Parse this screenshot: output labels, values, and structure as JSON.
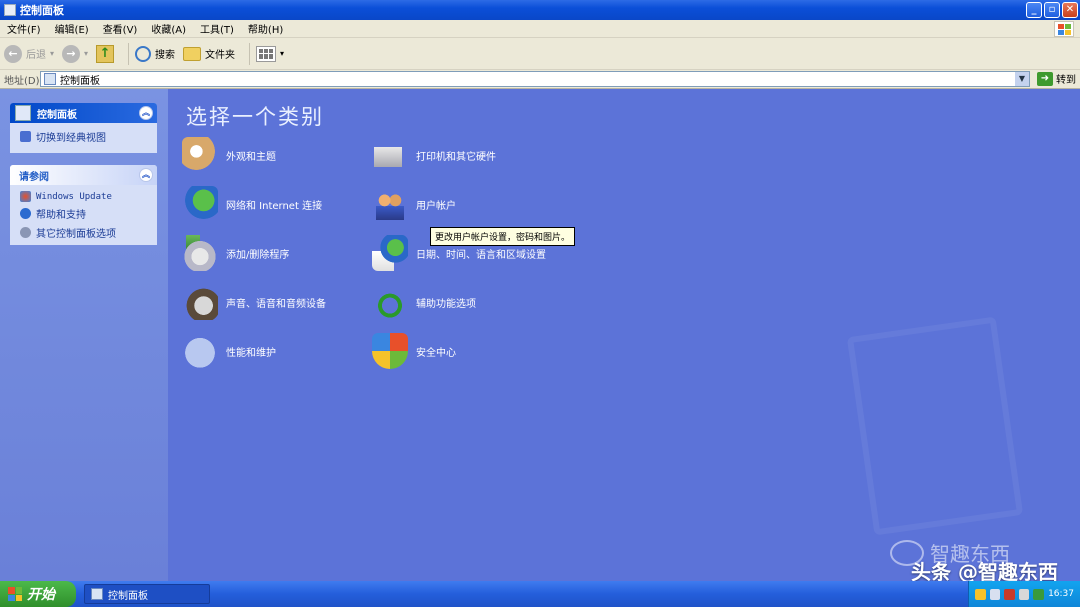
{
  "window": {
    "title": "控制面板"
  },
  "menu": [
    "文件(F)",
    "编辑(E)",
    "查看(V)",
    "收藏(A)",
    "工具(T)",
    "帮助(H)"
  ],
  "toolbar": {
    "back": "后退",
    "search": "搜索",
    "folders": "文件夹"
  },
  "address": {
    "label": "地址(D)",
    "value": "控制面板",
    "go": "转到"
  },
  "sidebar": {
    "panel1": {
      "title": "控制面板",
      "item": "切换到经典视图"
    },
    "panel2": {
      "title": "请参阅",
      "items": [
        "Windows Update",
        "帮助和支持",
        "其它控制面板选项"
      ]
    }
  },
  "main": {
    "title": "选择一个类别",
    "categories": [
      "外观和主题",
      "网络和 Internet 连接",
      "添加/删除程序",
      "声音、语音和音频设备",
      "性能和维护",
      "打印机和其它硬件",
      "用户帐户",
      "日期、时间、语言和区域设置",
      "辅助功能选项",
      "安全中心"
    ],
    "tooltip": "更改用户帐户设置，密码和图片。"
  },
  "taskbar": {
    "start": "开始",
    "task": "控制面板",
    "clock": "16:37"
  },
  "overlay": {
    "watermark": "智趣东西",
    "credit": "头条 @智趣东西"
  },
  "colors": {
    "main_bg": "#5c73d8",
    "title_bar": "#0b4fd8",
    "start": "#3a9f36"
  }
}
